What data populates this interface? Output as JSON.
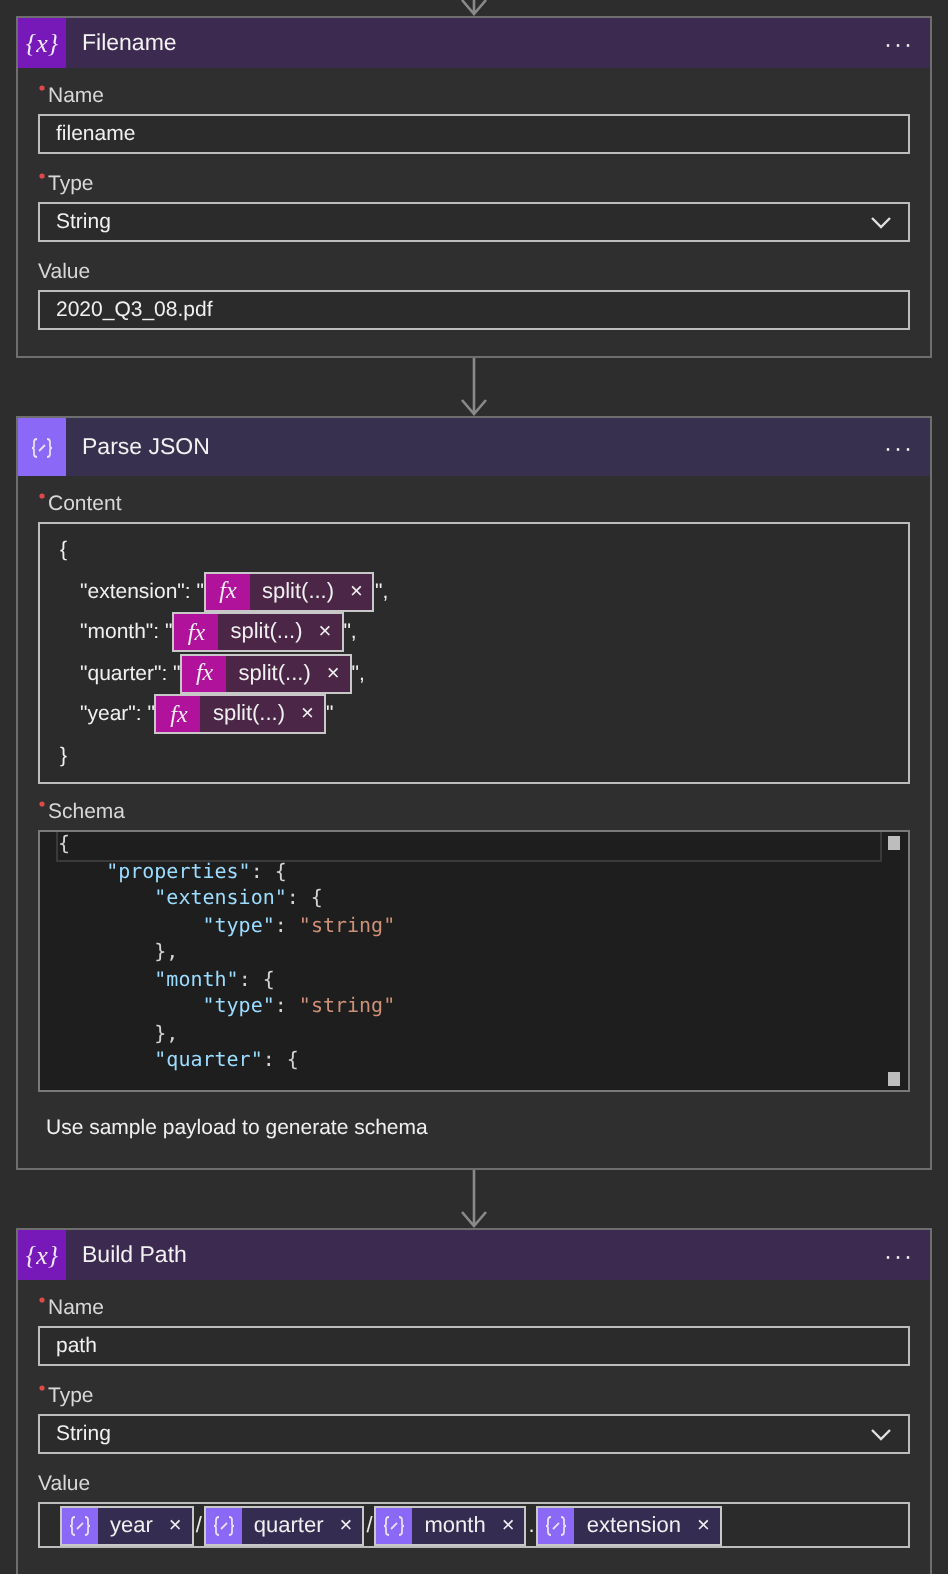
{
  "steps": [
    {
      "kind": "variable",
      "icon": "{x}",
      "title": "Filename",
      "menu": "···",
      "fields": [
        {
          "kind": "text",
          "label": "Name",
          "required": true,
          "value": "filename"
        },
        {
          "kind": "select",
          "label": "Type",
          "required": true,
          "value": "String"
        },
        {
          "kind": "text",
          "label": "Value",
          "required": false,
          "value": "2020_Q3_08.pdf"
        }
      ]
    },
    {
      "kind": "parse",
      "title": "Parse JSON",
      "menu": "···",
      "fields": [
        {
          "kind": "content",
          "label": "Content",
          "required": true,
          "lines": [
            {
              "parts": [
                {
                  "kind": "text",
                  "text": "{"
                }
              ]
            },
            {
              "parts": [
                {
                  "kind": "text",
                  "text": "\"extension\": \""
                },
                {
                  "kind": "expression",
                  "badge": "fx",
                  "label": "split(...)",
                  "close": "×"
                },
                {
                  "kind": "text",
                  "text": "\","
                }
              ]
            },
            {
              "parts": [
                {
                  "kind": "text",
                  "text": "\"month\": \""
                },
                {
                  "kind": "expression",
                  "badge": "fx",
                  "label": "split(...)",
                  "close": "×"
                },
                {
                  "kind": "text",
                  "text": "\","
                }
              ]
            },
            {
              "parts": [
                {
                  "kind": "text",
                  "text": "\"quarter\": \""
                },
                {
                  "kind": "expression",
                  "badge": "fx",
                  "label": "split(...)",
                  "close": "×"
                },
                {
                  "kind": "text",
                  "text": "\","
                }
              ]
            },
            {
              "parts": [
                {
                  "kind": "text",
                  "text": "\"year\": \""
                },
                {
                  "kind": "expression",
                  "badge": "fx",
                  "label": "split(...)",
                  "close": "×"
                },
                {
                  "kind": "text",
                  "text": "\""
                }
              ]
            },
            {
              "parts": [
                {
                  "kind": "text",
                  "text": "}"
                }
              ]
            }
          ]
        },
        {
          "kind": "code",
          "label": "Schema",
          "required": true,
          "lines": [
            [
              {
                "kind": "plain",
                "text": "{"
              }
            ],
            [
              {
                "kind": "key",
                "text": "    \"properties\""
              },
              {
                "kind": "plain",
                "text": ": {"
              }
            ],
            [
              {
                "kind": "key",
                "text": "        \"extension\""
              },
              {
                "kind": "plain",
                "text": ": {"
              }
            ],
            [
              {
                "kind": "key",
                "text": "            \"type\""
              },
              {
                "kind": "plain",
                "text": ": "
              },
              {
                "kind": "string",
                "text": "\"string\""
              }
            ],
            [
              {
                "kind": "plain",
                "text": "        },"
              }
            ],
            [
              {
                "kind": "key",
                "text": "        \"month\""
              },
              {
                "kind": "plain",
                "text": ": {"
              }
            ],
            [
              {
                "kind": "key",
                "text": "            \"type\""
              },
              {
                "kind": "plain",
                "text": ": "
              },
              {
                "kind": "string",
                "text": "\"string\""
              }
            ],
            [
              {
                "kind": "plain",
                "text": "        },"
              }
            ],
            [
              {
                "kind": "key",
                "text": "        \"quarter\""
              },
              {
                "kind": "plain",
                "text": ": {"
              }
            ]
          ]
        },
        {
          "kind": "link",
          "text": "Use sample payload to generate schema"
        }
      ]
    },
    {
      "kind": "variable",
      "icon": "{x}",
      "title": "Build Path",
      "menu": "···",
      "fields": [
        {
          "kind": "text",
          "label": "Name",
          "required": true,
          "value": "path"
        },
        {
          "kind": "select",
          "label": "Type",
          "required": true,
          "value": "String"
        },
        {
          "kind": "tokens",
          "label": "Value",
          "required": false,
          "parts": [
            {
              "kind": "variable",
              "label": "year",
              "close": "×"
            },
            {
              "kind": "text",
              "text": "/"
            },
            {
              "kind": "variable",
              "label": "quarter",
              "close": "×"
            },
            {
              "kind": "text",
              "text": "/"
            },
            {
              "kind": "variable",
              "label": "month",
              "close": "×"
            },
            {
              "kind": "text",
              "text": "."
            },
            {
              "kind": "variable",
              "label": "extension",
              "close": "×"
            }
          ]
        }
      ]
    }
  ]
}
